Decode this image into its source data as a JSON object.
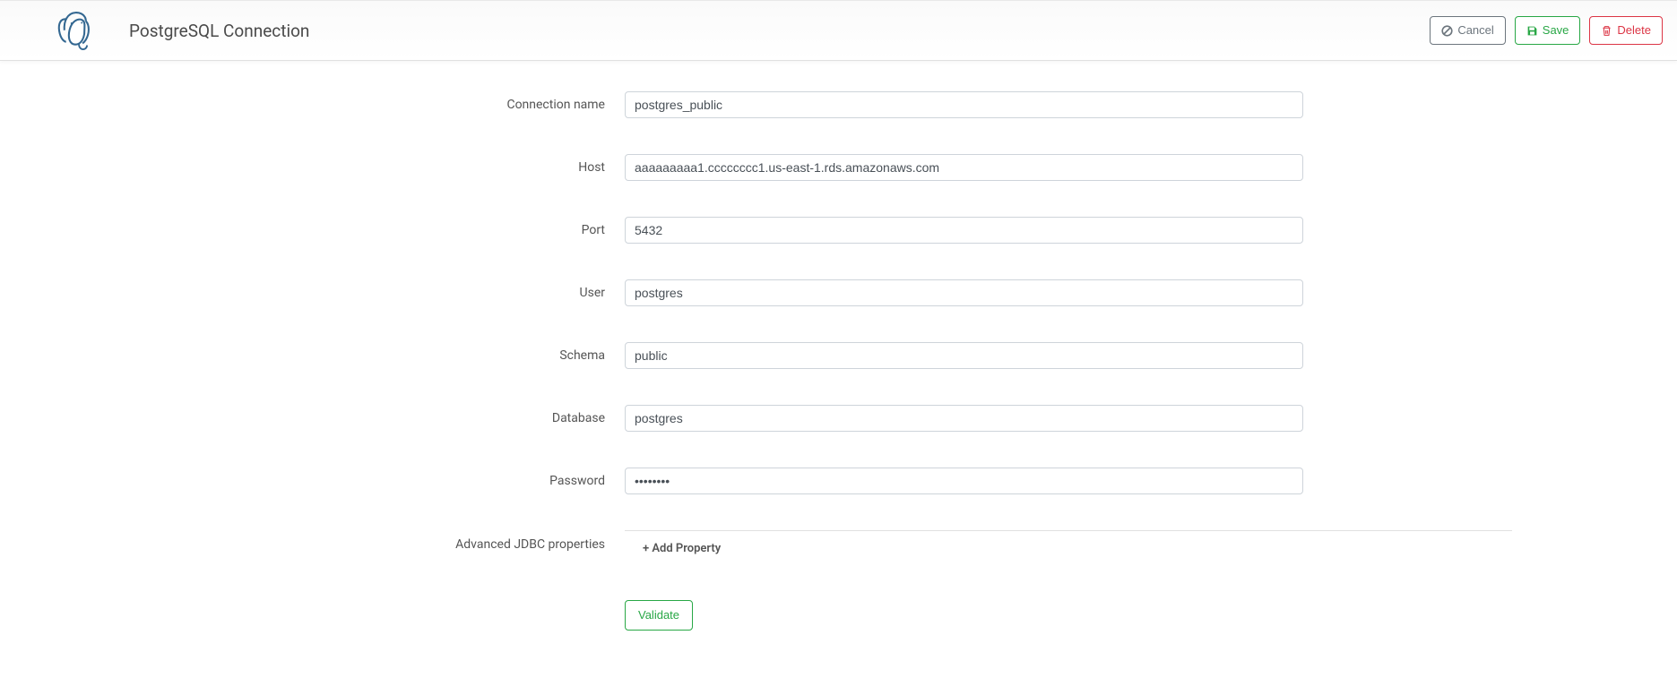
{
  "header": {
    "title": "PostgreSQL Connection",
    "cancel_label": "Cancel",
    "save_label": "Save",
    "delete_label": "Delete"
  },
  "form": {
    "connection_name": {
      "label": "Connection name",
      "value": "postgres_public"
    },
    "host": {
      "label": "Host",
      "value": "aaaaaaaaa1.cccccccc1.us-east-1.rds.amazonaws.com"
    },
    "port": {
      "label": "Port",
      "value": "5432"
    },
    "user": {
      "label": "User",
      "value": "postgres"
    },
    "schema": {
      "label": "Schema",
      "value": "public"
    },
    "database": {
      "label": "Database",
      "value": "postgres"
    },
    "password": {
      "label": "Password",
      "value": "••••••••"
    },
    "advanced": {
      "label": "Advanced JDBC properties",
      "add_property_label": "+ Add Property"
    },
    "validate_label": "Validate"
  }
}
